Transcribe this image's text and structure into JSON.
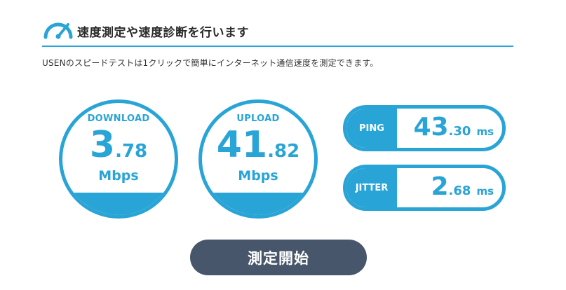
{
  "header": {
    "title": "速度測定や速度診断を行います",
    "icon": "speedometer-icon"
  },
  "description": "USENのスピードテストは1クリックで簡単にインターネット通信速度を測定できます。",
  "download": {
    "label": "DOWNLOAD",
    "int": "3",
    "dec": ".78",
    "unit": "Mbps"
  },
  "upload": {
    "label": "UPLOAD",
    "int": "41",
    "dec": ".82",
    "unit": "Mbps"
  },
  "ping": {
    "label": "PING",
    "int": "43",
    "dec": ".30",
    "unit": "ms"
  },
  "jitter": {
    "label": "JITTER",
    "int": "2",
    "dec": ".68",
    "unit": "ms"
  },
  "start_button": {
    "label": "測定開始"
  },
  "colors": {
    "accent": "#29a4d6",
    "button": "#47566a"
  }
}
